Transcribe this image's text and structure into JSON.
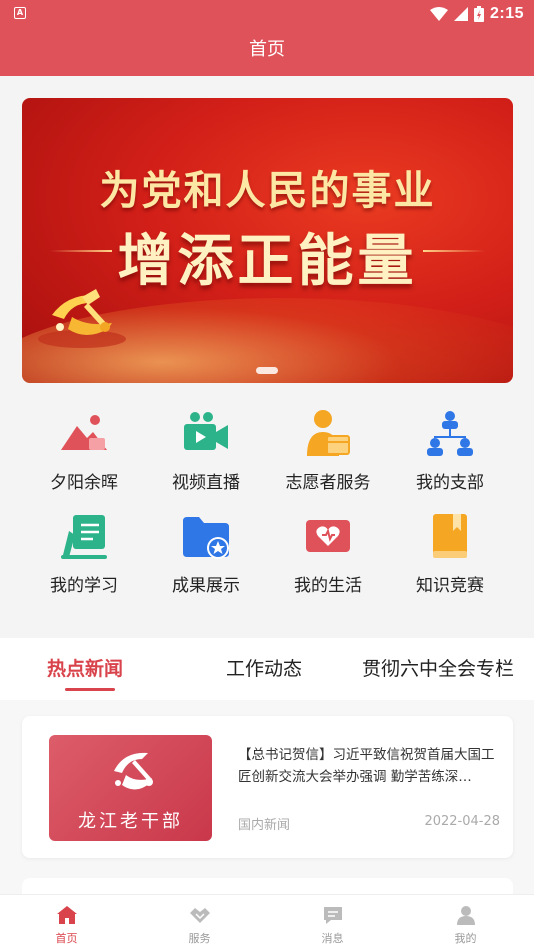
{
  "status_bar": {
    "time": "2:15"
  },
  "header": {
    "title": "首页"
  },
  "banner": {
    "line1": "为党和人民的事业",
    "line2": "增添正能量"
  },
  "quick_menu": [
    {
      "label": "夕阳余晖",
      "icon": "sunset-mountain-icon"
    },
    {
      "label": "视频直播",
      "icon": "video-camera-icon"
    },
    {
      "label": "志愿者服务",
      "icon": "volunteer-icon"
    },
    {
      "label": "我的支部",
      "icon": "org-branch-icon"
    },
    {
      "label": "我的学习",
      "icon": "study-icon"
    },
    {
      "label": "成果展示",
      "icon": "folder-star-icon"
    },
    {
      "label": "我的生活",
      "icon": "heart-card-icon"
    },
    {
      "label": "知识竞赛",
      "icon": "book-icon"
    }
  ],
  "news_tabs": [
    {
      "label": "热点新闻",
      "active": true
    },
    {
      "label": "工作动态",
      "active": false
    },
    {
      "label": "贯彻六中全会专栏",
      "active": false
    }
  ],
  "news": [
    {
      "thumb_text": "龙江老干部",
      "title": "【总书记贺信】习近平致信祝贺首届大国工匠创新交流大会举办强调 勤学苦练深…",
      "category": "国内新闻",
      "date": "2022-04-28"
    }
  ],
  "bottom_nav": [
    {
      "label": "首页",
      "icon": "home-icon",
      "active": true
    },
    {
      "label": "服务",
      "icon": "handshake-icon",
      "active": false
    },
    {
      "label": "消息",
      "icon": "message-icon",
      "active": false
    },
    {
      "label": "我的",
      "icon": "user-icon",
      "active": false
    }
  ],
  "colors": {
    "primary": "#e0525a",
    "accent": "#d9434b",
    "banner_red": "#d21f18",
    "icon_red": "#e05259",
    "icon_green": "#2db38a",
    "icon_blue": "#2f76e6",
    "icon_orange": "#f5a623"
  }
}
